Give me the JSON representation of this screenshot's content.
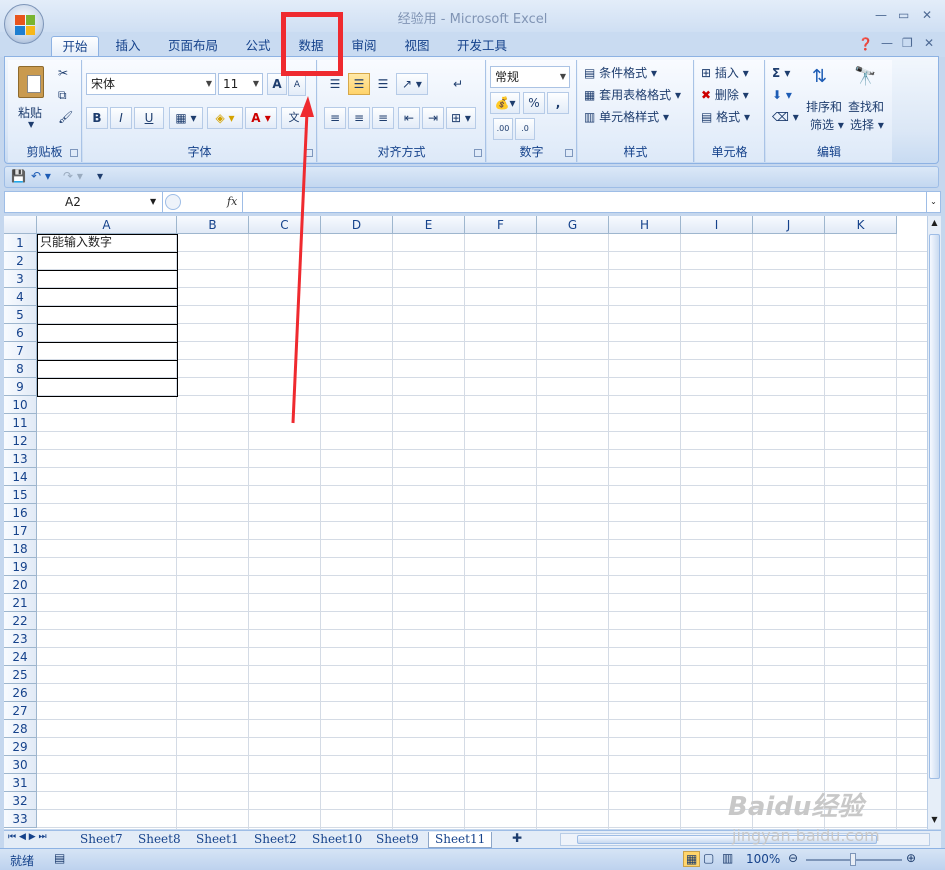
{
  "window": {
    "title": "经验用 - Microsoft Excel"
  },
  "tabs": [
    "开始",
    "插入",
    "页面布局",
    "公式",
    "数据",
    "审阅",
    "视图",
    "开发工具"
  ],
  "ribbon": {
    "clipboard": {
      "label": "剪贴板",
      "paste": "粘贴"
    },
    "font": {
      "label": "字体",
      "name": "宋体",
      "size": "11",
      "bold": "B",
      "italic": "I",
      "underline": "U",
      "grow": "A",
      "shrink": "A",
      "wen": "文"
    },
    "alignment": {
      "label": "对齐方式"
    },
    "number": {
      "label": "数字",
      "format": "常规",
      "percent": "%",
      "comma": ","
    },
    "styles": {
      "label": "样式",
      "cond": "条件格式",
      "table": "套用表格格式",
      "cell": "单元格样式"
    },
    "cells": {
      "label": "单元格",
      "insert": "插入",
      "delete": "删除",
      "format": "格式"
    },
    "editing": {
      "label": "编辑",
      "sort1": "排序和",
      "sort2": "筛选",
      "find1": "查找和",
      "find2": "选择",
      "sigma": "Σ"
    }
  },
  "formula_bar": {
    "name_box": "A2",
    "fx": "fx",
    "value": ""
  },
  "columns": [
    "A",
    "B",
    "C",
    "D",
    "E",
    "F",
    "G",
    "H",
    "I",
    "J",
    "K"
  ],
  "rows": [
    "1",
    "2",
    "3",
    "4",
    "5",
    "6",
    "7",
    "8",
    "9",
    "10",
    "11",
    "12",
    "13",
    "14",
    "15",
    "16",
    "17",
    "18",
    "19",
    "20",
    "21",
    "22",
    "23",
    "24",
    "25",
    "26",
    "27",
    "28",
    "29",
    "30",
    "31",
    "32",
    "33"
  ],
  "cells": {
    "A1": "只能输入数字"
  },
  "sheets": [
    "Sheet7",
    "Sheet8",
    "Sheet1",
    "Sheet2",
    "Sheet10",
    "Sheet9",
    "Sheet11"
  ],
  "active_sheet": "Sheet11",
  "status": {
    "ready": "就绪",
    "zoom": "100%"
  },
  "watermark": {
    "logo": "Baidu经验",
    "url": "jingyan.baidu.com"
  },
  "colors": {
    "highlight": "#ef2a2f",
    "accent": "#15428b"
  }
}
